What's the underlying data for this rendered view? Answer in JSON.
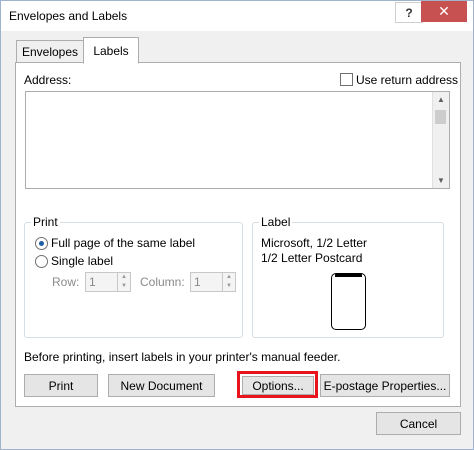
{
  "window": {
    "title": "Envelopes and Labels",
    "help_label": "?",
    "close_label": "✕"
  },
  "tabs": [
    {
      "label": "Envelopes"
    },
    {
      "label": "Labels"
    }
  ],
  "address": {
    "label": "Address:",
    "value": ""
  },
  "use_return_address": {
    "label": "Use return address",
    "checked": false
  },
  "print_group": {
    "label": "Print",
    "full_page": "Full page of the same label",
    "single_label": "Single label",
    "row_label": "Row:",
    "row_value": "1",
    "column_label": "Column:",
    "column_value": "1"
  },
  "label_group": {
    "label": "Label",
    "line1": "Microsoft, 1/2 Letter",
    "line2": "1/2 Letter Postcard"
  },
  "note": "Before printing, insert labels in your printer's manual feeder.",
  "buttons": {
    "print": "Print",
    "new_document": "New Document",
    "options": "Options...",
    "epostage": "E-postage Properties...",
    "cancel": "Cancel"
  },
  "colors": {
    "highlight": "#e8141b",
    "close_button": "#c75050"
  }
}
